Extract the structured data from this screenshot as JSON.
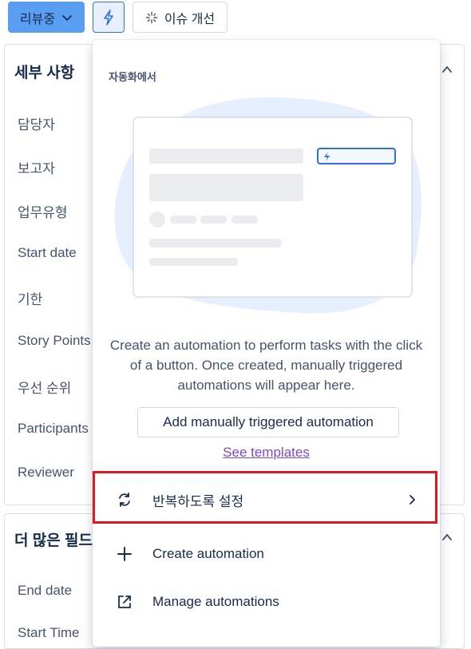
{
  "toolbar": {
    "status_label": "리뷰중",
    "improve_label": "이슈 개선",
    "colors": {
      "status_bg": "#5a9ef2",
      "bolt": "#2f6fe4"
    }
  },
  "details_panel": {
    "title": "세부 사항",
    "fields": [
      "담당자",
      "보고자",
      "업무유형",
      "Start date",
      "기한",
      "Story Points",
      "우선 순위",
      "Participants",
      "Reviewer"
    ]
  },
  "more_panel": {
    "title": "더 많은 필드",
    "fields": [
      "End date",
      "Start Time"
    ]
  },
  "automation_popup": {
    "heading": "자동화에서",
    "empty_text": "Create an automation to perform tasks with the click of a button. Once created, manually triggered automations will appear here.",
    "add_button": "Add manually triggered automation",
    "templates_link": "See templates",
    "menu": [
      {
        "label": "반복하도록 설정",
        "icon": "repeat-icon",
        "has_chevron": true,
        "highlighted": true
      },
      {
        "label": "Create automation",
        "icon": "plus-icon"
      },
      {
        "label": "Manage automations",
        "icon": "external-link-icon"
      }
    ],
    "colors": {
      "highlight": "#e0191f",
      "link": "#7b48c8",
      "blob": "#e6effd"
    }
  }
}
